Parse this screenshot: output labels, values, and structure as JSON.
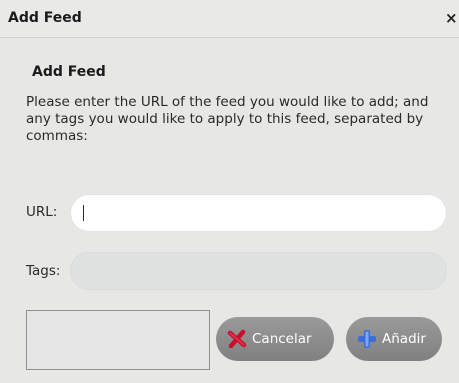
{
  "window": {
    "title": "Add Feed",
    "close_icon": "close-icon",
    "close_glyph": "×"
  },
  "header": {
    "title": "Add Feed"
  },
  "instructions": "Please enter the URL of the feed you would like to add; and any tags you would like to apply to this feed, separated by commas:",
  "form": {
    "url_label": "URL:",
    "url_value": "",
    "tags_label": "Tags:",
    "tags_value": ""
  },
  "buttons": {
    "cancel": {
      "label": "Cancelar",
      "icon": "cancel-x-icon"
    },
    "add": {
      "label": "Añadir",
      "icon": "add-plus-icon"
    }
  },
  "colors": {
    "dialog_background": "#e7e7e5",
    "button_background": "#8d8d8d",
    "cancel_icon": "#c8102e",
    "add_icon": "#3a6fd8"
  }
}
